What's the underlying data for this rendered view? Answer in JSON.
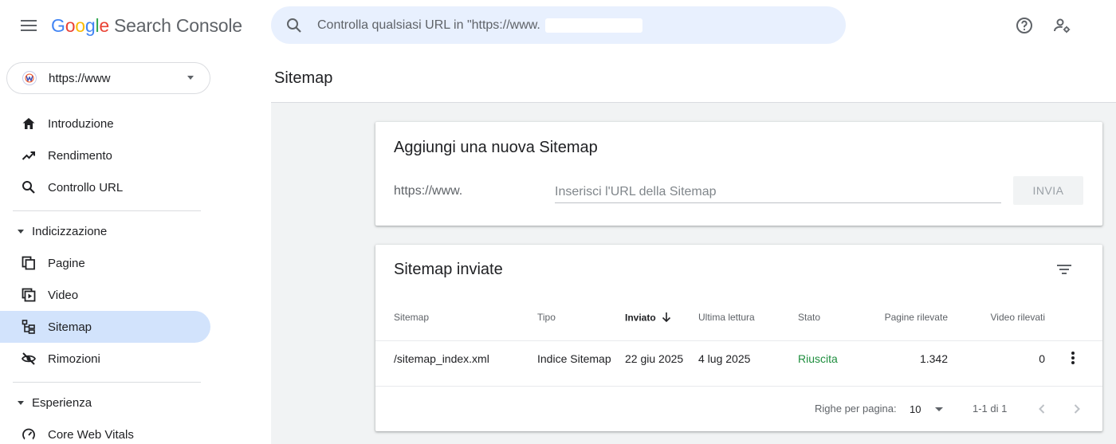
{
  "header": {
    "logo_parts": [
      "G",
      "o",
      "o",
      "g",
      "l",
      "e"
    ],
    "product": "Search Console",
    "search_placeholder": "Controlla qualsiasi URL in \"https://www."
  },
  "property": {
    "label": "https://www"
  },
  "sidebar": {
    "items_top": [
      {
        "label": "Introduzione",
        "icon": "home-icon"
      },
      {
        "label": "Rendimento",
        "icon": "trending-icon"
      },
      {
        "label": "Controllo URL",
        "icon": "search-icon"
      }
    ],
    "section_indexing": "Indicizzazione",
    "items_indexing": [
      {
        "label": "Pagine",
        "icon": "pages-icon"
      },
      {
        "label": "Video",
        "icon": "video-icon"
      },
      {
        "label": "Sitemap",
        "icon": "sitemap-icon",
        "active": true
      },
      {
        "label": "Rimozioni",
        "icon": "removals-icon"
      }
    ],
    "section_experience": "Esperienza",
    "items_experience": [
      {
        "label": "Core Web Vitals",
        "icon": "gauge-icon"
      }
    ]
  },
  "page": {
    "title": "Sitemap"
  },
  "add_card": {
    "title": "Aggiungi una nuova Sitemap",
    "prefix": "https://www.",
    "input_placeholder": "Inserisci l'URL della Sitemap",
    "submit_label": "INVIA"
  },
  "submitted_card": {
    "title": "Sitemap inviate",
    "columns": [
      "Sitemap",
      "Tipo",
      "Inviato",
      "Ultima lettura",
      "Stato",
      "Pagine rilevate",
      "Video rilevati"
    ],
    "rows": [
      {
        "sitemap": "/sitemap_index.xml",
        "type": "Indice Sitemap",
        "submitted": "22 giu 2025",
        "last_read": "4 lug 2025",
        "status": "Riuscita",
        "pages": "1.342",
        "videos": "0"
      }
    ],
    "footer": {
      "rows_per_page_label": "Righe per pagina:",
      "rows_per_page_value": "10",
      "range": "1-1 di 1"
    }
  },
  "colors": {
    "accent_bg": "#d2e3fc",
    "search_bg": "#e8f0fe",
    "success": "#1e8e3e"
  }
}
